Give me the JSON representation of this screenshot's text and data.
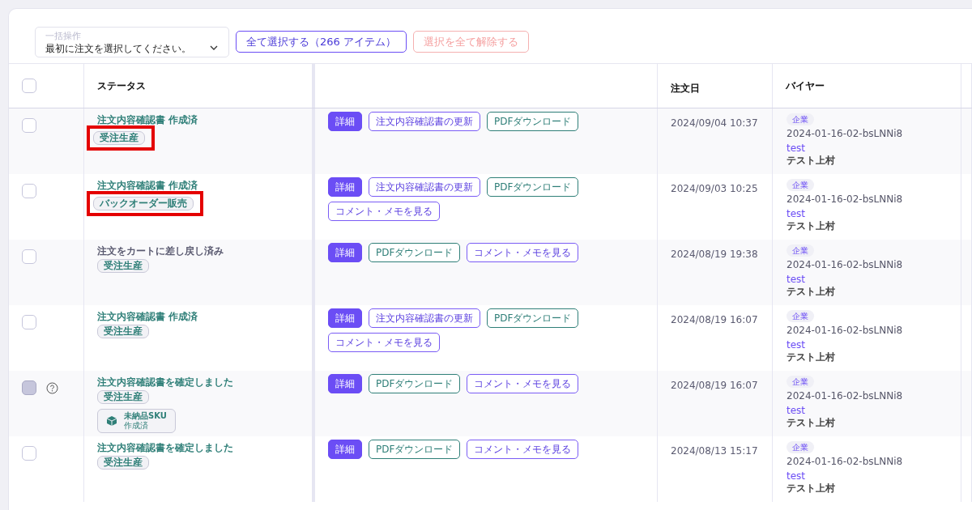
{
  "toolbar": {
    "bulk_action": {
      "placeholder": "一括操作",
      "value": "最初に注文を選択してください。"
    },
    "select_all": {
      "label": "全て選択する（266 アイテム）",
      "disabled": false
    },
    "deselect_all": {
      "label": "選択を全て解除する",
      "disabled": true
    }
  },
  "table": {
    "header_checkbox": {
      "checked": false
    },
    "columns": [
      "ステータス",
      "",
      "注文日",
      "バイヤー"
    ],
    "rows": [
      {
        "checkbox": {
          "disabled": false,
          "checked": false
        },
        "status": "注文内容確認書 作成済",
        "muted": false,
        "tags": [
          {
            "kind": "plain",
            "label": "受注生産",
            "highlighted": true
          }
        ],
        "actions": [
          {
            "kind": "primary",
            "label": "詳細"
          },
          {
            "kind": "outline",
            "label": "注文内容確認書の更新"
          },
          {
            "kind": "download",
            "label": "PDFダウンロード"
          }
        ],
        "date": "2024/09/04 10:37",
        "buyer": {
          "type": "企業",
          "code": "2024-01-16-02-bsLNNi8",
          "link": "test",
          "name": "テスト上村"
        }
      },
      {
        "checkbox": {
          "disabled": false,
          "checked": false
        },
        "status": "注文内容確認書 作成済",
        "muted": false,
        "tags": [
          {
            "kind": "plain",
            "label": "バックオーダー販売",
            "highlighted": true
          }
        ],
        "actions": [
          {
            "kind": "primary",
            "label": "詳細"
          },
          {
            "kind": "outline",
            "label": "注文内容確認書の更新"
          },
          {
            "kind": "download",
            "label": "PDFダウンロード"
          },
          {
            "kind": "outline",
            "label": "コメント・メモを見る"
          }
        ],
        "date": "2024/09/03 10:25",
        "buyer": {
          "type": "企業",
          "code": "2024-01-16-02-bsLNNi8",
          "link": "test",
          "name": "テスト上村"
        }
      },
      {
        "checkbox": {
          "disabled": false,
          "checked": false
        },
        "status": "注文をカートに差し戻し済み",
        "muted": true,
        "tags": [
          {
            "kind": "plain",
            "label": "受注生産",
            "highlighted": false
          }
        ],
        "actions": [
          {
            "kind": "primary",
            "label": "詳細"
          },
          {
            "kind": "download",
            "label": "PDFダウンロード"
          },
          {
            "kind": "outline",
            "label": "コメント・メモを見る"
          }
        ],
        "date": "2024/08/19 19:38",
        "buyer": {
          "type": "企業",
          "code": "2024-01-16-02-bsLNNi8",
          "link": "test",
          "name": "テスト上村"
        }
      },
      {
        "checkbox": {
          "disabled": false,
          "checked": false
        },
        "status": "注文内容確認書 作成済",
        "muted": false,
        "tags": [
          {
            "kind": "plain",
            "label": "受注生産",
            "highlighted": false
          }
        ],
        "actions": [
          {
            "kind": "primary",
            "label": "詳細"
          },
          {
            "kind": "outline",
            "label": "注文内容確認書の更新"
          },
          {
            "kind": "download",
            "label": "PDFダウンロード"
          },
          {
            "kind": "outline",
            "label": "コメント・メモを見る"
          }
        ],
        "date": "2024/08/19 16:07",
        "buyer": {
          "type": "企業",
          "code": "2024-01-16-02-bsLNNi8",
          "link": "test",
          "name": "テスト上村"
        }
      },
      {
        "checkbox": {
          "disabled": true,
          "checked": false
        },
        "status": "注文内容確認書を確定しました",
        "muted": false,
        "tags": [
          {
            "kind": "plain",
            "label": "受注生産",
            "highlighted": false
          },
          {
            "kind": "sku",
            "label": "未納品SKU",
            "sub": "作成済",
            "highlighted": false
          }
        ],
        "actions": [
          {
            "kind": "primary",
            "label": "詳細"
          },
          {
            "kind": "download",
            "label": "PDFダウンロード"
          },
          {
            "kind": "outline",
            "label": "コメント・メモを見る"
          }
        ],
        "date": "2024/08/19 16:07",
        "buyer": {
          "type": "企業",
          "code": "2024-01-16-02-bsLNNi8",
          "link": "test",
          "name": "テスト上村"
        }
      },
      {
        "checkbox": {
          "disabled": false,
          "checked": false
        },
        "status": "注文内容確認書を確定しました",
        "muted": false,
        "tags": [
          {
            "kind": "plain",
            "label": "受注生産",
            "highlighted": false
          }
        ],
        "actions": [
          {
            "kind": "primary",
            "label": "詳細"
          },
          {
            "kind": "download",
            "label": "PDFダウンロード"
          },
          {
            "kind": "outline",
            "label": "コメント・メモを見る"
          }
        ],
        "date": "2024/08/13 15:17",
        "buyer": {
          "type": "企業",
          "code": "2024-01-16-02-bsLNNi8",
          "link": "test",
          "name": "テスト上村"
        }
      }
    ]
  }
}
